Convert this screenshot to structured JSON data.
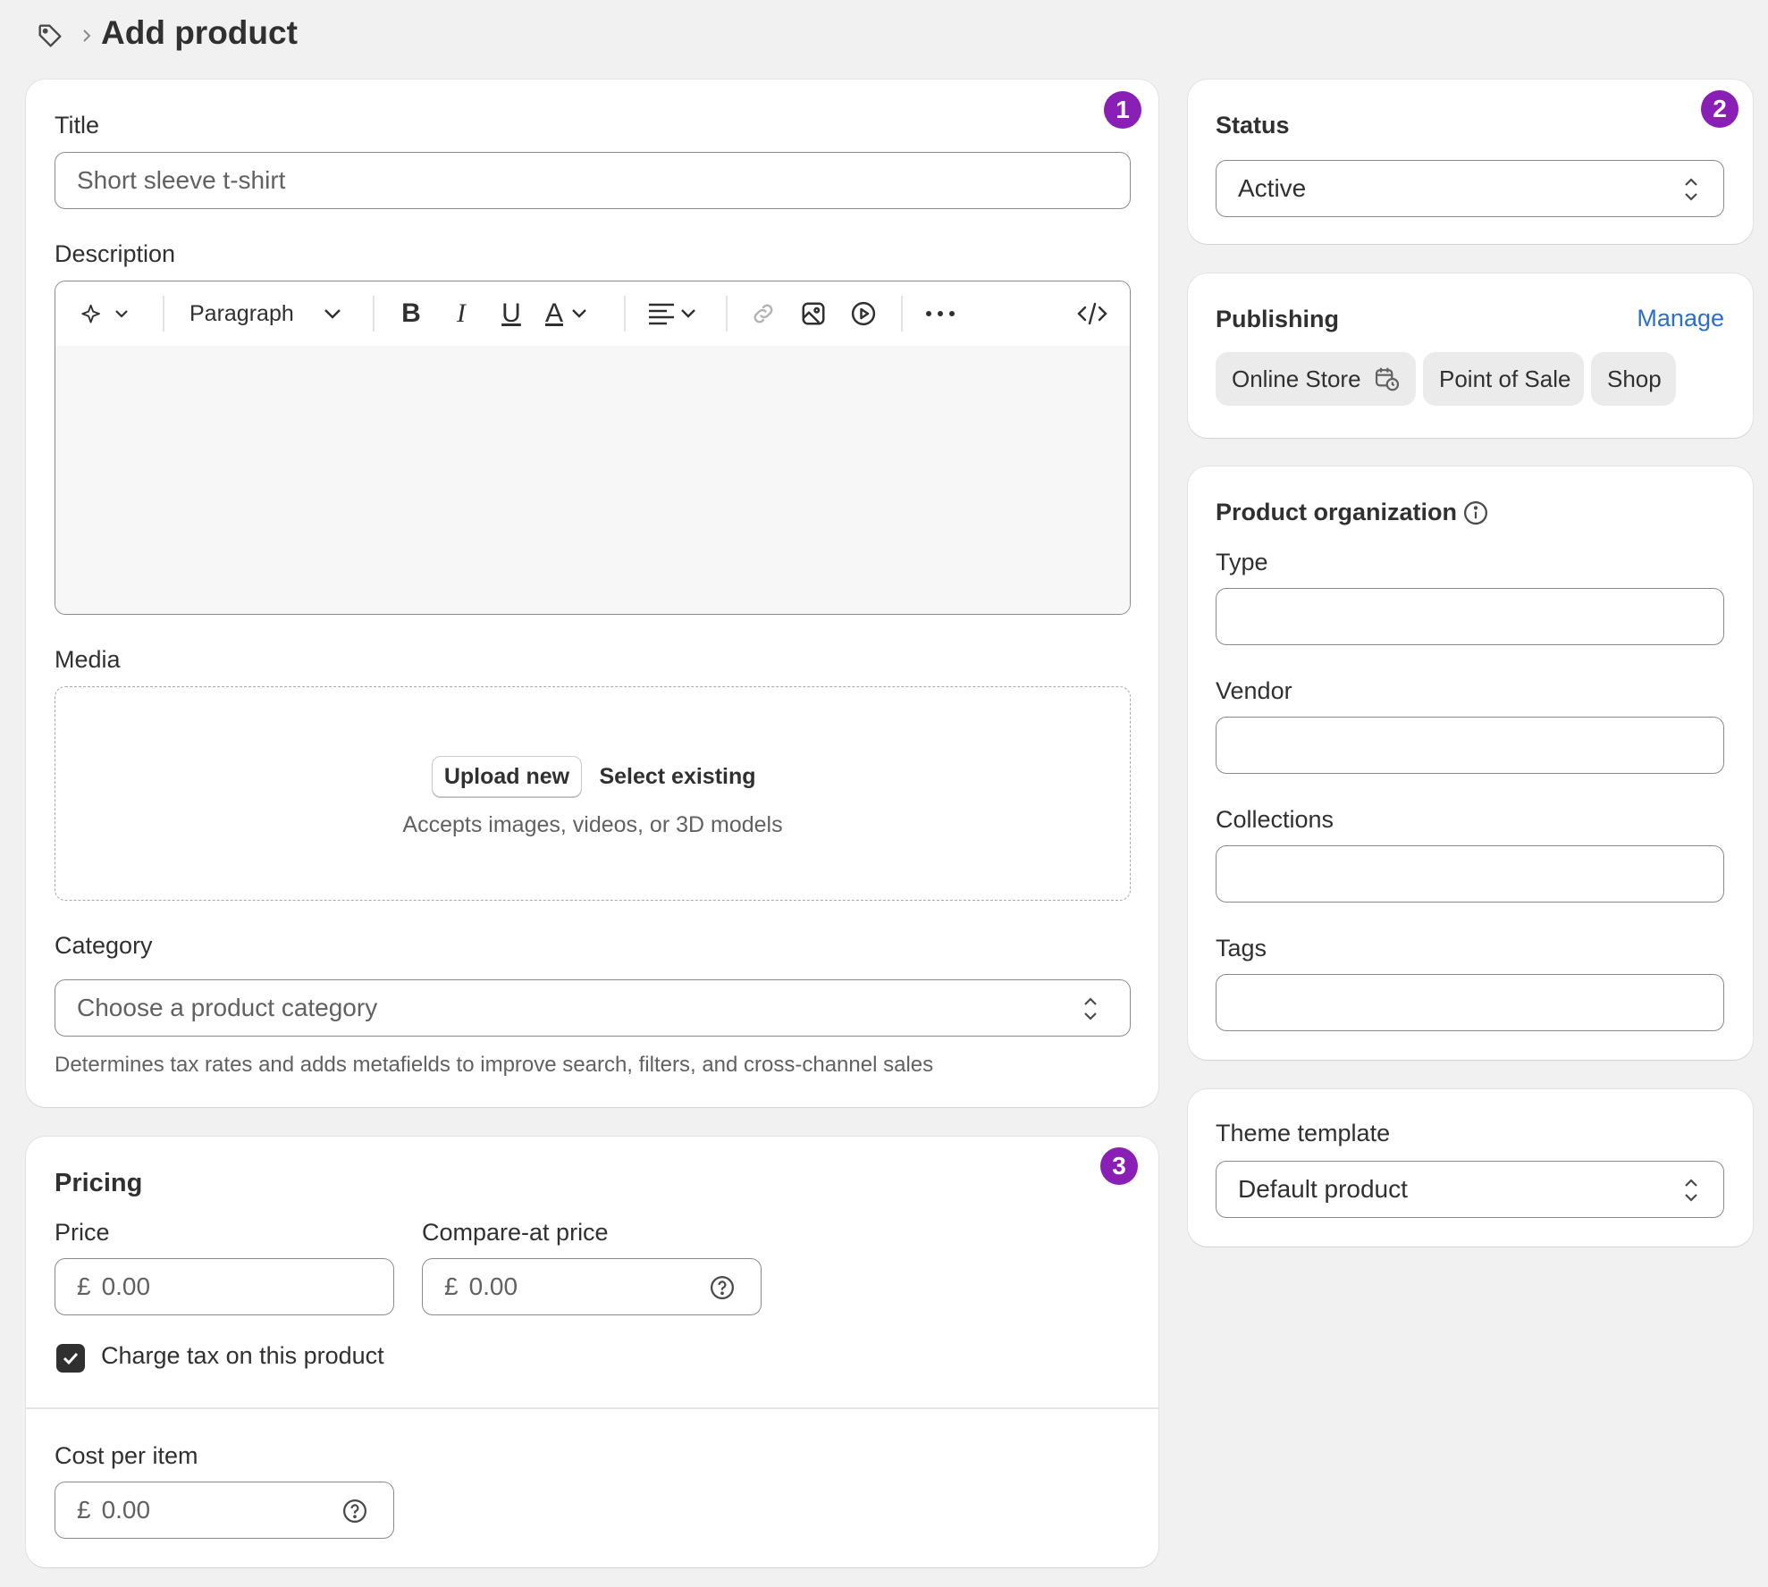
{
  "header": {
    "title": "Add product"
  },
  "main": {
    "badge": "1",
    "title_label": "Title",
    "title_placeholder": "Short sleeve t-shirt",
    "description_label": "Description",
    "toolbar": {
      "block_format": "Paragraph"
    },
    "media_label": "Media",
    "media": {
      "upload_label": "Upload new",
      "select_label": "Select existing",
      "hint": "Accepts images, videos, or 3D models"
    },
    "category_label": "Category",
    "category_placeholder": "Choose a product category",
    "category_help": "Determines tax rates and adds metafields to improve search, filters, and cross-channel sales"
  },
  "pricing": {
    "badge": "3",
    "heading": "Pricing",
    "price_label": "Price",
    "price_currency": "£",
    "price_placeholder": "0.00",
    "compare_label": "Compare-at price",
    "compare_currency": "£",
    "compare_placeholder": "0.00",
    "charge_tax_label": "Charge tax on this product",
    "charge_tax_checked": true,
    "cost_label": "Cost per item",
    "cost_currency": "£",
    "cost_placeholder": "0.00"
  },
  "status": {
    "badge": "2",
    "heading": "Status",
    "value": "Active"
  },
  "publishing": {
    "heading": "Publishing",
    "manage_label": "Manage",
    "channels": [
      "Online Store",
      "Point of Sale",
      "Shop"
    ]
  },
  "organization": {
    "heading": "Product organization",
    "type_label": "Type",
    "vendor_label": "Vendor",
    "collections_label": "Collections",
    "tags_label": "Tags"
  },
  "theme": {
    "heading": "Theme template",
    "value": "Default product"
  },
  "colors": {
    "badge": "#8a1fb5",
    "link": "#2c6ecb",
    "background": "#f1f1f1"
  }
}
